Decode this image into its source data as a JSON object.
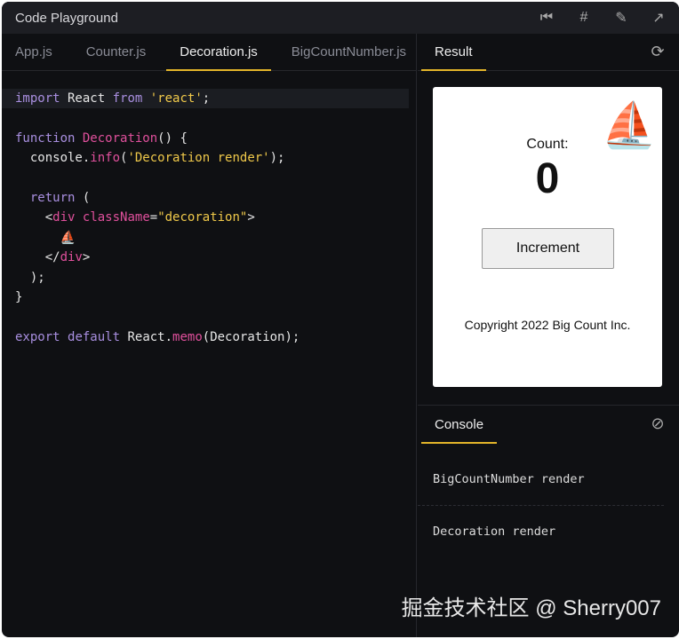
{
  "title": "Code Playground",
  "toolbar": {
    "reset": "⏮",
    "format": "#",
    "edit": "✎",
    "open": "↗"
  },
  "file_tabs": [
    "App.js",
    "Counter.js",
    "Decoration.js",
    "BigCountNumber.js"
  ],
  "active_tab": 2,
  "code": [
    [
      [
        "kw",
        "import"
      ],
      [
        "pl",
        " React "
      ],
      [
        "kw",
        "from"
      ],
      [
        "pl",
        " "
      ],
      [
        "str",
        "'react'"
      ],
      [
        "pl",
        ";"
      ]
    ],
    [],
    [
      [
        "kw",
        "function"
      ],
      [
        "pl",
        " "
      ],
      [
        "fn",
        "Decoration"
      ],
      [
        "pl",
        "() {"
      ]
    ],
    [
      [
        "pl",
        "  console."
      ],
      [
        "fn",
        "info"
      ],
      [
        "pl",
        "("
      ],
      [
        "str",
        "'Decoration render'"
      ],
      [
        "pl",
        ");"
      ]
    ],
    [],
    [
      [
        "kw",
        "  return"
      ],
      [
        "pl",
        " ("
      ]
    ],
    [
      [
        "pl",
        "    <"
      ],
      [
        "fn",
        "div"
      ],
      [
        "pl",
        " "
      ],
      [
        "fn",
        "className"
      ],
      [
        "pl",
        "="
      ],
      [
        "str",
        "\"decoration\""
      ],
      [
        "pl",
        ">"
      ]
    ],
    [
      [
        "pl",
        "      ⛵"
      ]
    ],
    [
      [
        "pl",
        "    </"
      ],
      [
        "fn",
        "div"
      ],
      [
        "pl",
        ">"
      ]
    ],
    [
      [
        "pl",
        "  );"
      ]
    ],
    [
      [
        "pl",
        "}"
      ]
    ],
    [],
    [
      [
        "kw",
        "export"
      ],
      [
        "pl",
        " "
      ],
      [
        "kw",
        "default"
      ],
      [
        "pl",
        " React."
      ],
      [
        "fn",
        "memo"
      ],
      [
        "pl",
        "(Decoration);"
      ]
    ]
  ],
  "result": {
    "tab": "Result",
    "refresh": "⟳",
    "count_label": "Count:",
    "count": "0",
    "button": "Increment",
    "copyright": "Copyright 2022 Big Count Inc.",
    "boat": "⛵"
  },
  "console": {
    "tab": "Console",
    "clear": "⊘",
    "messages": [
      "BigCountNumber render",
      "Decoration render"
    ]
  },
  "watermark": "掘金技术社区 @ Sherry007"
}
